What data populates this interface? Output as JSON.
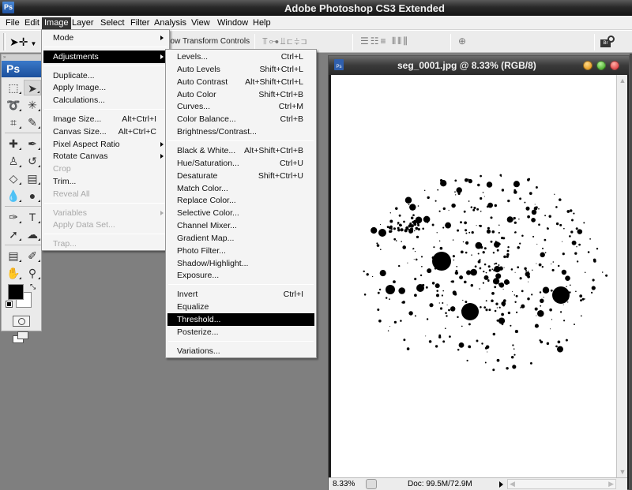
{
  "app": {
    "title": "Adobe Photoshop CS3 Extended",
    "logo": "Ps"
  },
  "menubar": [
    {
      "label": "File"
    },
    {
      "label": "Edit"
    },
    {
      "label": "Image",
      "active": true
    },
    {
      "label": "Layer"
    },
    {
      "label": "Select"
    },
    {
      "label": "Filter"
    },
    {
      "label": "Analysis"
    },
    {
      "label": "View"
    },
    {
      "label": "Window"
    },
    {
      "label": "Help"
    }
  ],
  "options_bar": {
    "tool_preset_icon": "move-tool-icon",
    "show_transform_controls": "how Transform Controls",
    "align_icons": [
      "align-top-icon",
      "align-vcenter-icon",
      "align-bottom-icon",
      "align-left-icon",
      "align-hcenter-icon",
      "align-right-icon"
    ],
    "distribute_icons": [
      "distribute-top-icon",
      "distribute-vcenter-icon",
      "distribute-bottom-icon",
      "distribute-left-icon",
      "distribute-hcenter-icon",
      "distribute-right-icon"
    ],
    "auto_align_icon": "auto-align-icon",
    "bridge_icon": "bridge-icon"
  },
  "tools_palette": {
    "badge": "Ps",
    "tools": [
      {
        "name": "marquee-tool",
        "glyph": "⬚"
      },
      {
        "name": "move-tool",
        "glyph": "➤"
      },
      {
        "name": "lasso-tool",
        "glyph": "➰"
      },
      {
        "name": "magic-wand-tool",
        "glyph": "✳"
      },
      {
        "name": "crop-tool",
        "glyph": "⌗"
      },
      {
        "name": "slice-tool",
        "glyph": "✎"
      },
      {
        "name": "healing-brush-tool",
        "glyph": "✚"
      },
      {
        "name": "brush-tool",
        "glyph": "✒"
      },
      {
        "name": "clone-stamp-tool",
        "glyph": "♙"
      },
      {
        "name": "history-brush-tool",
        "glyph": "↺"
      },
      {
        "name": "eraser-tool",
        "glyph": "◇"
      },
      {
        "name": "gradient-tool",
        "glyph": "▤"
      },
      {
        "name": "blur-tool",
        "glyph": "💧"
      },
      {
        "name": "dodge-tool",
        "glyph": "●"
      },
      {
        "name": "pen-tool",
        "glyph": "✑"
      },
      {
        "name": "type-tool",
        "glyph": "T"
      },
      {
        "name": "path-selection-tool",
        "glyph": "➚"
      },
      {
        "name": "shape-tool",
        "glyph": "☁"
      },
      {
        "name": "notes-tool",
        "glyph": "▤"
      },
      {
        "name": "eyedropper-tool",
        "glyph": "✐"
      },
      {
        "name": "hand-tool",
        "glyph": "✋"
      },
      {
        "name": "zoom-tool",
        "glyph": "⚲"
      }
    ],
    "foreground_color": "#000000",
    "background_color": "#ffffff"
  },
  "image_menu": {
    "items": [
      {
        "label": "Mode",
        "submenu": true
      },
      {
        "sep": true
      },
      {
        "label": "Adjustments",
        "submenu": true,
        "highlighted": true
      },
      {
        "sep": true
      },
      {
        "label": "Duplicate..."
      },
      {
        "label": "Apply Image..."
      },
      {
        "label": "Calculations..."
      },
      {
        "sep": true
      },
      {
        "label": "Image Size...",
        "shortcut": "Alt+Ctrl+I"
      },
      {
        "label": "Canvas Size...",
        "shortcut": "Alt+Ctrl+C"
      },
      {
        "label": "Pixel Aspect Ratio",
        "submenu": true
      },
      {
        "label": "Rotate Canvas",
        "submenu": true
      },
      {
        "label": "Crop",
        "disabled": true
      },
      {
        "label": "Trim..."
      },
      {
        "label": "Reveal All",
        "disabled": true
      },
      {
        "sep": true
      },
      {
        "label": "Variables",
        "submenu": true,
        "disabled": true
      },
      {
        "label": "Apply Data Set...",
        "disabled": true
      },
      {
        "sep": true
      },
      {
        "label": "Trap...",
        "disabled": true
      }
    ]
  },
  "adjustments_menu": {
    "items": [
      {
        "label": "Levels...",
        "shortcut": "Ctrl+L"
      },
      {
        "label": "Auto Levels",
        "shortcut": "Shift+Ctrl+L"
      },
      {
        "label": "Auto Contrast",
        "shortcut": "Alt+Shift+Ctrl+L"
      },
      {
        "label": "Auto Color",
        "shortcut": "Shift+Ctrl+B"
      },
      {
        "label": "Curves...",
        "shortcut": "Ctrl+M"
      },
      {
        "label": "Color Balance...",
        "shortcut": "Ctrl+B"
      },
      {
        "label": "Brightness/Contrast..."
      },
      {
        "sep": true
      },
      {
        "label": "Black & White...",
        "shortcut": "Alt+Shift+Ctrl+B"
      },
      {
        "label": "Hue/Saturation...",
        "shortcut": "Ctrl+U"
      },
      {
        "label": "Desaturate",
        "shortcut": "Shift+Ctrl+U"
      },
      {
        "label": "Match Color..."
      },
      {
        "label": "Replace Color..."
      },
      {
        "label": "Selective Color..."
      },
      {
        "label": "Channel Mixer..."
      },
      {
        "label": "Gradient Map..."
      },
      {
        "label": "Photo Filter..."
      },
      {
        "label": "Shadow/Highlight..."
      },
      {
        "label": "Exposure..."
      },
      {
        "sep": true
      },
      {
        "label": "Invert",
        "shortcut": "Ctrl+I"
      },
      {
        "label": "Equalize"
      },
      {
        "label": "Threshold...",
        "highlighted": true
      },
      {
        "label": "Posterize..."
      },
      {
        "sep": true
      },
      {
        "label": "Variations..."
      }
    ]
  },
  "document": {
    "title": "seg_0001.jpg @ 8.33% (RGB/8)",
    "icon": "Ps",
    "zoom": "8.33%",
    "doc_size": "Doc: 99.5M/72.9M",
    "content_description": "black ink splatter dots on white background"
  }
}
